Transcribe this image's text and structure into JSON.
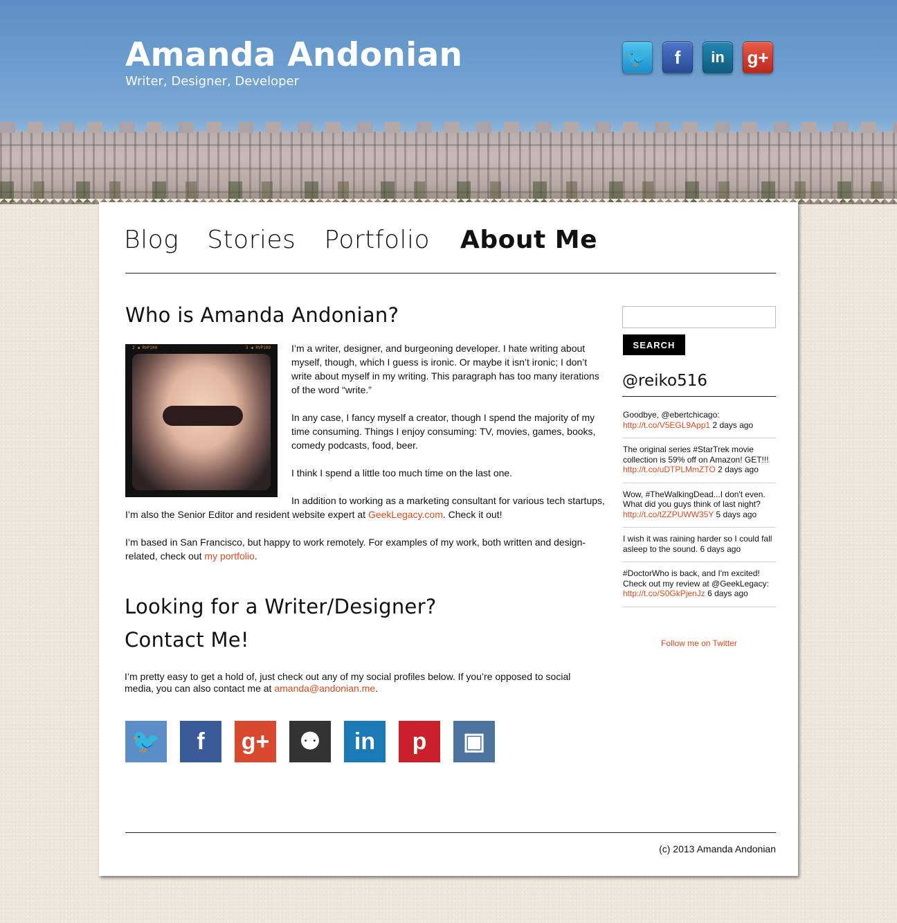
{
  "header": {
    "title": "Amanda Andonian",
    "tagline": "Writer, Designer, Developer",
    "social_top": [
      {
        "name": "twitter-icon",
        "glyph": "🐦",
        "color": "#1d8fcc"
      },
      {
        "name": "facebook-icon",
        "glyph": "f",
        "color": "#2a4b98"
      },
      {
        "name": "linkedin-icon",
        "glyph": "in",
        "color": "#0f5b80"
      },
      {
        "name": "google-plus-icon",
        "glyph": "g+",
        "color": "#b9281b"
      }
    ]
  },
  "nav": {
    "items": [
      "Blog",
      "Stories",
      "Portfolio",
      "About Me"
    ],
    "active": "About Me"
  },
  "about": {
    "heading": "Who is Amanda Andonian?",
    "p1": "I’m a writer, designer, and burgeoning developer. I hate writing about myself, though, which I guess is ironic. Or maybe it isn’t ironic; I don’t write about myself in my writing. This paragraph has too many iterations of the word “write.”",
    "p2": "In any case, I fancy myself a creator, though I spend the majority of my time consuming. Things I enjoy consuming: TV, movies, games, books, comedy podcasts, food, beer.",
    "p3": "I think I spend a little too much time on the last one.",
    "p4_a": "In addition to working as a marketing consultant for various tech startups,",
    "p4_b": "I’m also the Senior Editor and resident website expert at ",
    "p4_link": "GeekLegacy.com",
    "p4_c": ". Check it out!",
    "p5_a": "I’m based in San Francisco, but happy to work remotely. For examples of my work, both written and design-",
    "p5_b": "related, check out ",
    "p5_link": "my portfolio",
    "p5_c": "."
  },
  "contact": {
    "heading1": "Looking for a Writer/Designer?",
    "heading2": "Contact Me!",
    "p_a": "I’m pretty easy to get a hold of, just check out any of my social profiles below. If you’re opposed to social",
    "p_b": "media, you can also contact me at ",
    "email": "amanda@andonian.me",
    "p_c": "."
  },
  "social_bottom": [
    {
      "name": "twitter-icon",
      "glyph": "🐦"
    },
    {
      "name": "facebook-icon",
      "glyph": "f"
    },
    {
      "name": "google-plus-icon",
      "glyph": "g+"
    },
    {
      "name": "github-icon",
      "glyph": "⚉"
    },
    {
      "name": "linkedin-icon",
      "glyph": "in"
    },
    {
      "name": "pinterest-icon",
      "glyph": "p"
    },
    {
      "name": "instagram-icon",
      "glyph": "▣"
    }
  ],
  "sidebar": {
    "search_placeholder": "",
    "search_label": "SEARCH",
    "handle": "@reiko516",
    "tweets": [
      {
        "text": "Goodbye, @ebertchicago:",
        "link": "http://t.co/V5EGL9App1",
        "ago": "2 days ago"
      },
      {
        "text": "The original series #StarTrek movie collection is 59% off on Amazon! GET!!!",
        "link": "http://t.co/uDTPLMmZTO",
        "ago": "2 days ago"
      },
      {
        "text": "Wow, #TheWalkingDead...I don't even. What did you guys think of last night?",
        "link": "http://t.co/tZZPUWW35Y",
        "ago": "5 days ago"
      },
      {
        "text": "I wish it was raining harder so I could fall asleep to the sound.",
        "link": "",
        "ago": "6 days ago"
      },
      {
        "text": "#DoctorWho is back, and I'm excited! Check out my review at @GeekLegacy:",
        "link": "http://t.co/S0GkPjenJz",
        "ago": "6 days ago"
      }
    ],
    "follow_label": "Follow me on Twitter"
  },
  "footer": {
    "copyright": "(c) 2013 Amanda Andonian"
  },
  "colors": {
    "link": "#d94a1c",
    "panel": "#ffffff",
    "background": "#ede7de"
  }
}
